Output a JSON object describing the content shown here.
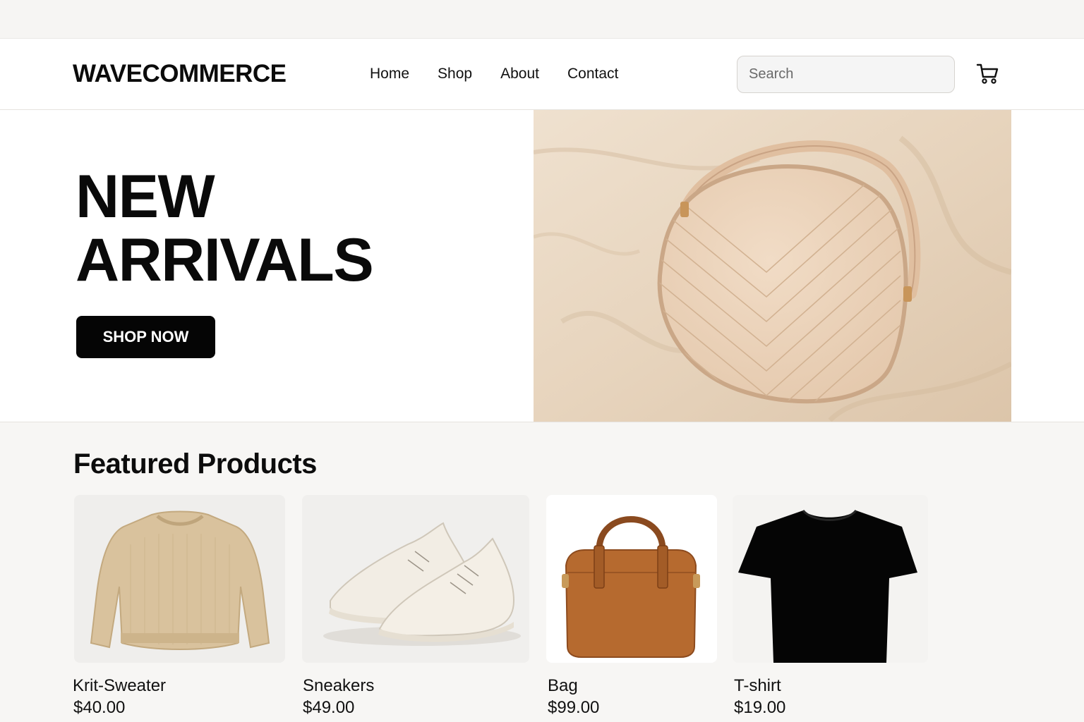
{
  "header": {
    "logo": "WAVECOMMERCE",
    "nav": [
      "Home",
      "Shop",
      "About",
      "Contact"
    ],
    "search_placeholder": "Search",
    "cart_icon": "cart-icon"
  },
  "hero": {
    "title_line1": "NEW",
    "title_line2": "ARRIVALS",
    "cta": "SHOP NOW",
    "image": "quilted-round-bag-photo"
  },
  "featured": {
    "title": "Featured Products",
    "products": [
      {
        "name": "Krit-Sweater",
        "price": "$40.00",
        "image": "sweater-photo"
      },
      {
        "name": "Sneakers",
        "price": "$49.00",
        "image": "sneakers-photo"
      },
      {
        "name": "Bag",
        "price": "$99.00",
        "image": "bag-photo"
      },
      {
        "name": "T-shirt",
        "price": "$19.00",
        "image": "tshirt-photo"
      }
    ]
  },
  "colors": {
    "accent": "#050505",
    "background": "#f7f6f4",
    "hero_bg": "#ead9c4"
  }
}
